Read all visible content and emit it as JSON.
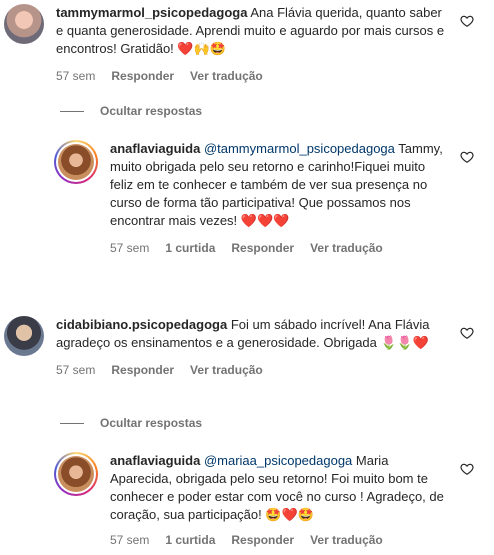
{
  "comments": [
    {
      "username": "tammymarmol_psicopedagoga",
      "text": "Ana Flávia querida, quanto saber e quanta generosidade. Aprendi muito e aguardo por mais cursos e encontros! Gratidão!",
      "emojis": "❤️🙌🤩",
      "age": "57 sem",
      "reply_label": "Responder",
      "translate_label": "Ver tradução",
      "hide_replies_label": "Ocultar respostas"
    },
    {
      "username": "anaflaviaguida",
      "mention": "@tammymarmol_psicopedagoga",
      "text": "Tammy, muito obrigada pelo seu retorno e carinho!Fiquei muito feliz em te conhecer e também de ver sua presença no curso de forma tão participativa! Que possamos nos encontrar mais vezes!",
      "emojis": "❤️❤️❤️",
      "age": "57 sem",
      "likes_label": "1 curtida",
      "reply_label": "Responder",
      "translate_label": "Ver tradução"
    },
    {
      "username": "cidabibiano.psicopedagoga",
      "text": "Foi um sábado incrível! Ana Flávia agradeço os ensinamentos e a generosidade. Obrigada",
      "emojis": "🌷🌷❤️",
      "age": "57 sem",
      "reply_label": "Responder",
      "translate_label": "Ver tradução",
      "hide_replies_label": "Ocultar respostas"
    },
    {
      "username": "anaflaviaguida",
      "mention": "@mariaa_psicopedagoga",
      "text": "Maria Aparecida, obrigada pelo seu retorno! Foi muito bom te conhecer e poder estar com você no curso ! Agradeço, de coração, sua participação!",
      "emojis": "🤩❤️🤩",
      "age": "57 sem",
      "likes_label": "1 curtida",
      "reply_label": "Responder",
      "translate_label": "Ver tradução"
    }
  ]
}
